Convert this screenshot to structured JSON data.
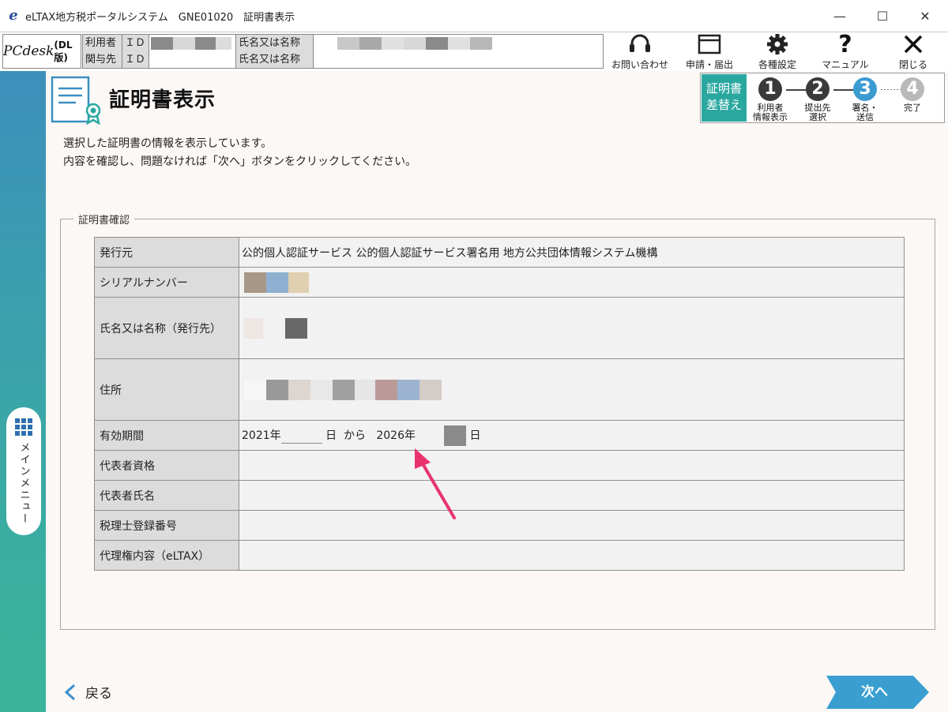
{
  "window": {
    "title": "eLTAX地方税ポータルシステム　GNE01020　証明書表示",
    "app_icon": "eltax-logo-icon",
    "minimize": "—",
    "maximize": "☐",
    "close": "✕"
  },
  "header": {
    "logo_main": "PCdesk",
    "logo_sub": "(DL版)",
    "user_label": "利用者",
    "related_label": "関与先",
    "id_label": "ＩＤ",
    "name_label": "氏名又は名称",
    "toolbar": [
      {
        "label": "お問い合わせ",
        "icon": "headset-icon"
      },
      {
        "label": "申請・届出",
        "icon": "window-icon"
      },
      {
        "label": "各種設定",
        "icon": "gear-icon"
      },
      {
        "label": "マニュアル",
        "icon": "question-icon"
      },
      {
        "label": "閉じる",
        "icon": "close-icon"
      }
    ]
  },
  "sidebar": {
    "menu_label": "メインメニュー"
  },
  "page": {
    "title": "証明書表示",
    "description_line1": "選択した証明書の情報を表示しています。",
    "description_line2": "内容を確認し、問題なければ「次へ」ボタンをクリックしてください。"
  },
  "steps": {
    "replace_line1": "証明書",
    "replace_line2": "差替え",
    "items": [
      {
        "num": "1",
        "line1": "利用者",
        "line2": "情報表示",
        "color": "#3a3a3a"
      },
      {
        "num": "2",
        "line1": "提出先",
        "line2": "選択",
        "color": "#3a3a3a"
      },
      {
        "num": "3",
        "line1": "署名・",
        "line2": "送信",
        "color": "#3b9bd0"
      },
      {
        "num": "4",
        "line1": "完了",
        "line2": "",
        "color": "#b8b8b8"
      }
    ]
  },
  "certificate": {
    "legend": "証明書確認",
    "rows": [
      {
        "label": "発行元",
        "value": "公的個人認証サービス 公的個人認証サービス署名用 地方公共団体情報システム機構"
      },
      {
        "label": "シリアルナンバー",
        "value": ""
      },
      {
        "label": "氏名又は名称（発行先）",
        "value": ""
      },
      {
        "label": "住所",
        "value": ""
      },
      {
        "label": "有効期間",
        "value": ""
      },
      {
        "label": "代表者資格",
        "value": ""
      },
      {
        "label": "代表者氏名",
        "value": ""
      },
      {
        "label": "税理士登録番号",
        "value": ""
      },
      {
        "label": "代理権内容（eLTAX）",
        "value": ""
      }
    ],
    "validity": {
      "from_year": "2021年",
      "day1": "日",
      "kara": "から",
      "to_year": "2026年",
      "day2": "日"
    }
  },
  "nav": {
    "back_label": "戻る",
    "next_label": "次へ"
  },
  "colors": {
    "accent_teal": "#2aa8a0",
    "next_button": "#3a9fd0",
    "arrow": "#e8336f"
  }
}
